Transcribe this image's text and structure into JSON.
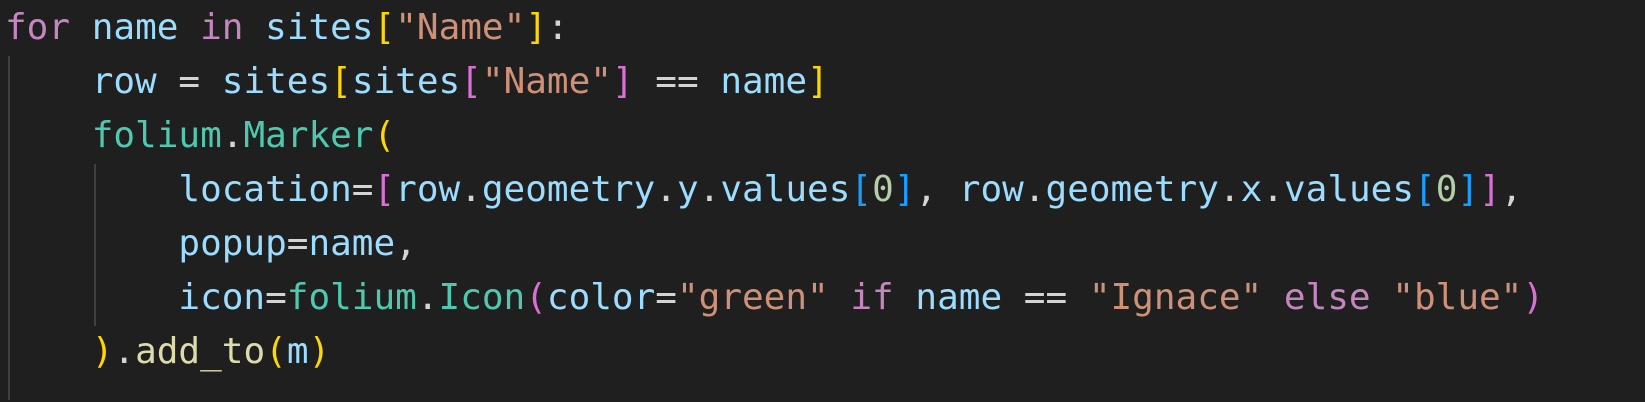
{
  "editor": {
    "language": "python",
    "lines": [
      [
        {
          "t": "for",
          "c": "kw"
        },
        {
          "t": " ",
          "c": "op"
        },
        {
          "t": "name",
          "c": "var"
        },
        {
          "t": " ",
          "c": "op"
        },
        {
          "t": "in",
          "c": "kw"
        },
        {
          "t": " ",
          "c": "op"
        },
        {
          "t": "sites",
          "c": "var"
        },
        {
          "t": "[",
          "c": "b1"
        },
        {
          "t": "\"Name\"",
          "c": "str"
        },
        {
          "t": "]",
          "c": "b1"
        },
        {
          "t": ":",
          "c": "op"
        }
      ],
      [
        {
          "t": "    ",
          "c": "op"
        },
        {
          "t": "row",
          "c": "var"
        },
        {
          "t": " = ",
          "c": "op"
        },
        {
          "t": "sites",
          "c": "var"
        },
        {
          "t": "[",
          "c": "b1"
        },
        {
          "t": "sites",
          "c": "var"
        },
        {
          "t": "[",
          "c": "b2"
        },
        {
          "t": "\"Name\"",
          "c": "str"
        },
        {
          "t": "]",
          "c": "b2"
        },
        {
          "t": " == ",
          "c": "op"
        },
        {
          "t": "name",
          "c": "var"
        },
        {
          "t": "]",
          "c": "b1"
        }
      ],
      [
        {
          "t": "    ",
          "c": "op"
        },
        {
          "t": "folium",
          "c": "cls"
        },
        {
          "t": ".",
          "c": "op"
        },
        {
          "t": "Marker",
          "c": "cls"
        },
        {
          "t": "(",
          "c": "b1"
        }
      ],
      [
        {
          "t": "        ",
          "c": "op"
        },
        {
          "t": "location",
          "c": "var"
        },
        {
          "t": "=",
          "c": "op"
        },
        {
          "t": "[",
          "c": "b2"
        },
        {
          "t": "row",
          "c": "var"
        },
        {
          "t": ".",
          "c": "op"
        },
        {
          "t": "geometry",
          "c": "var"
        },
        {
          "t": ".",
          "c": "op"
        },
        {
          "t": "y",
          "c": "var"
        },
        {
          "t": ".",
          "c": "op"
        },
        {
          "t": "values",
          "c": "var"
        },
        {
          "t": "[",
          "c": "b3"
        },
        {
          "t": "0",
          "c": "num"
        },
        {
          "t": "]",
          "c": "b3"
        },
        {
          "t": ", ",
          "c": "op"
        },
        {
          "t": "row",
          "c": "var"
        },
        {
          "t": ".",
          "c": "op"
        },
        {
          "t": "geometry",
          "c": "var"
        },
        {
          "t": ".",
          "c": "op"
        },
        {
          "t": "x",
          "c": "var"
        },
        {
          "t": ".",
          "c": "op"
        },
        {
          "t": "values",
          "c": "var"
        },
        {
          "t": "[",
          "c": "b3"
        },
        {
          "t": "0",
          "c": "num"
        },
        {
          "t": "]",
          "c": "b3"
        },
        {
          "t": "]",
          "c": "b2"
        },
        {
          "t": ",",
          "c": "op"
        }
      ],
      [
        {
          "t": "        ",
          "c": "op"
        },
        {
          "t": "popup",
          "c": "var"
        },
        {
          "t": "=",
          "c": "op"
        },
        {
          "t": "name",
          "c": "var"
        },
        {
          "t": ",",
          "c": "op"
        }
      ],
      [
        {
          "t": "        ",
          "c": "op"
        },
        {
          "t": "icon",
          "c": "var"
        },
        {
          "t": "=",
          "c": "op"
        },
        {
          "t": "folium",
          "c": "cls"
        },
        {
          "t": ".",
          "c": "op"
        },
        {
          "t": "Icon",
          "c": "cls"
        },
        {
          "t": "(",
          "c": "b2"
        },
        {
          "t": "color",
          "c": "var"
        },
        {
          "t": "=",
          "c": "op"
        },
        {
          "t": "\"green\"",
          "c": "str"
        },
        {
          "t": " ",
          "c": "op"
        },
        {
          "t": "if",
          "c": "kw"
        },
        {
          "t": " ",
          "c": "op"
        },
        {
          "t": "name",
          "c": "var"
        },
        {
          "t": " == ",
          "c": "op"
        },
        {
          "t": "\"Ignace\"",
          "c": "str"
        },
        {
          "t": " ",
          "c": "op"
        },
        {
          "t": "else",
          "c": "kw"
        },
        {
          "t": " ",
          "c": "op"
        },
        {
          "t": "\"blue\"",
          "c": "str"
        },
        {
          "t": ")",
          "c": "b2"
        }
      ],
      [
        {
          "t": "    ",
          "c": "op"
        },
        {
          "t": ")",
          "c": "b1"
        },
        {
          "t": ".",
          "c": "op"
        },
        {
          "t": "add_to",
          "c": "fn"
        },
        {
          "t": "(",
          "c": "b1"
        },
        {
          "t": "m",
          "c": "var"
        },
        {
          "t": ")",
          "c": "b1"
        }
      ]
    ]
  }
}
